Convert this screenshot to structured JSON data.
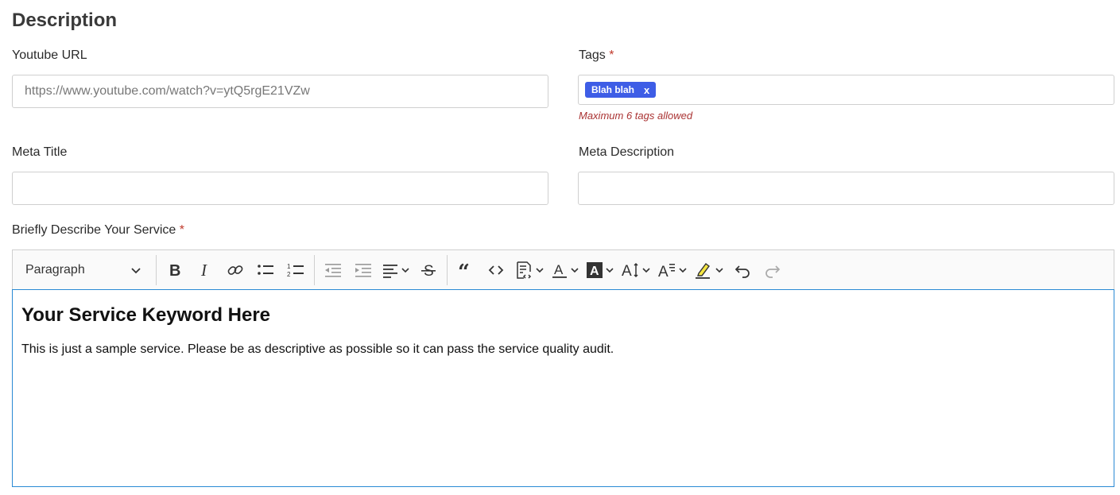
{
  "section": {
    "title": "Description"
  },
  "youtube": {
    "label": "Youtube URL",
    "placeholder": "https://www.youtube.com/watch?v=ytQ5rgE21VZw",
    "value": ""
  },
  "tags": {
    "label": "Tags",
    "required_mark": "*",
    "items": [
      {
        "label": "Blah blah",
        "remove": "x"
      }
    ],
    "hint": "Maximum 6 tags allowed"
  },
  "meta_title": {
    "label": "Meta Title",
    "value": ""
  },
  "meta_description": {
    "label": "Meta Description",
    "value": ""
  },
  "service": {
    "label": "Briefly Describe Your Service",
    "required_mark": "*",
    "toolbar": {
      "paragraph_select": "Paragraph",
      "buttons": [
        "bold",
        "italic",
        "link",
        "bulleted-list",
        "numbered-list",
        "outdent",
        "indent",
        "align",
        "strikethrough",
        "block-quote",
        "code",
        "insert-template",
        "font-color",
        "font-background-color",
        "font-size",
        "font-family",
        "highlight",
        "undo",
        "redo"
      ]
    },
    "content": {
      "heading": "Your Service Keyword Here",
      "body": "This is just a sample service. Please be as descriptive as possible so it can pass the service quality audit."
    }
  },
  "colors": {
    "tag_bg": "#3e5de6",
    "required": "#c0392b",
    "hint": "#aa3333",
    "editor_focus": "#2a8ad4"
  }
}
